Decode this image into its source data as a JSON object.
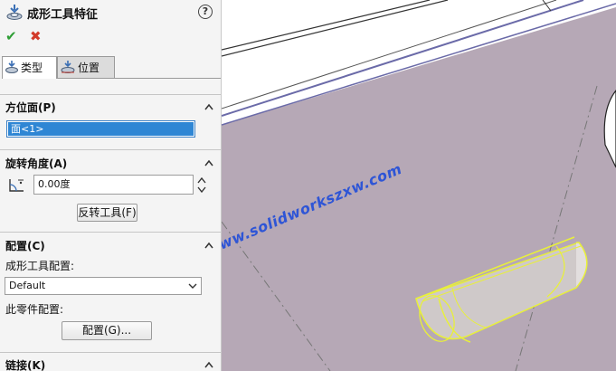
{
  "panel": {
    "title": "成形工具特征",
    "tabs": [
      {
        "label": "类型",
        "active": true
      },
      {
        "label": "位置",
        "active": false
      }
    ],
    "sections": {
      "orientation": {
        "title": "方位面(P)",
        "selection": "面<1>"
      },
      "rotation": {
        "title": "旋转角度(A)",
        "angle_value": "0.00度",
        "flip_button": "反转工具(F)"
      },
      "configuration": {
        "title": "配置(C)",
        "tool_config_label": "成形工具配置:",
        "tool_config_value": "Default",
        "part_config_label": "此零件配置:",
        "config_button": "配置(G)..."
      },
      "link": {
        "title": "链接(K)"
      }
    }
  },
  "watermark": "www.solidworkszxw.com",
  "colors": {
    "accent": "#2f86d4",
    "viewport_bg": "#b6a8b6",
    "ok": "#2e9e35",
    "cancel": "#d23a2a",
    "highlight": "#e8f03a"
  }
}
